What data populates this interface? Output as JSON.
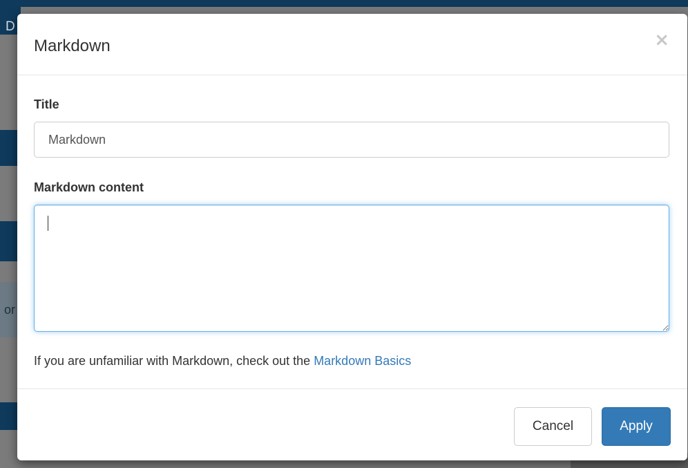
{
  "background": {
    "partial_letter": "D",
    "partial_text": "or"
  },
  "modal": {
    "title": "Markdown",
    "close_label": "×"
  },
  "form": {
    "title_label": "Title",
    "title_value": "Markdown",
    "content_label": "Markdown content",
    "content_value": ""
  },
  "help": {
    "text": "If you are unfamiliar with Markdown, check out the ",
    "link_text": "Markdown Basics"
  },
  "footer": {
    "cancel_label": "Cancel",
    "apply_label": "Apply"
  },
  "colors": {
    "primary": "#337ab7",
    "focus_border": "#66afe9",
    "backdrop": "#7b7b7b",
    "background_nav": "#0f3a5c"
  }
}
